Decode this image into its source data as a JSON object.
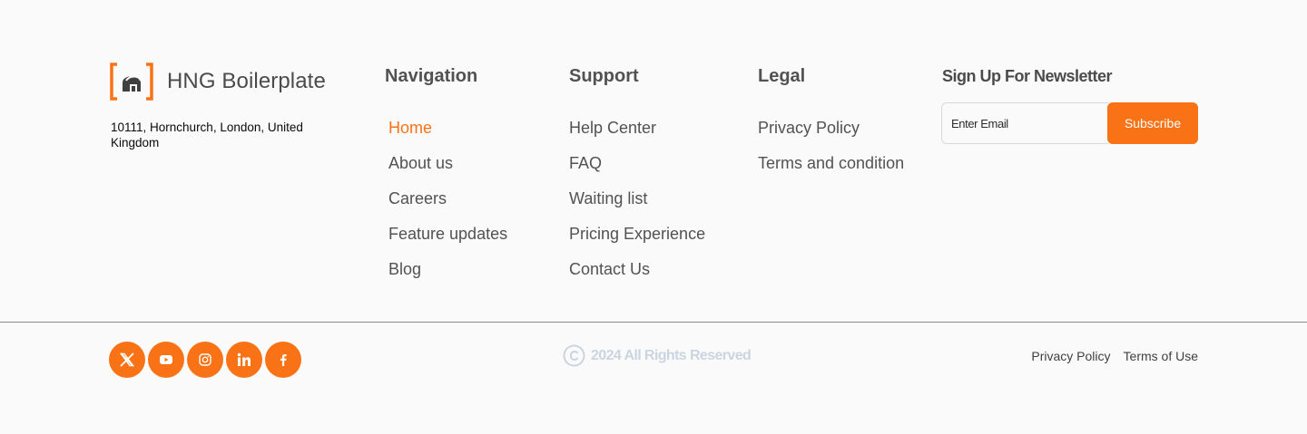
{
  "brand": {
    "name": "HNG Boilerplate",
    "address": "10111, Hornchurch, London, United Kingdom",
    "logo_icon": "bracket-house-logo-icon"
  },
  "columns": {
    "navigation": {
      "title": "Navigation",
      "items": [
        "Home",
        "About us",
        "Careers",
        "Feature updates",
        "Blog"
      ],
      "active": "Home"
    },
    "support": {
      "title": "Support",
      "items": [
        "Help Center",
        "FAQ",
        "Waiting list",
        "Pricing Experience",
        "Contact Us"
      ]
    },
    "legal": {
      "title": "Legal",
      "items": [
        "Privacy Policy",
        "Terms and condition"
      ]
    }
  },
  "newsletter": {
    "title": "Sign Up For Newsletter",
    "email_placeholder": "Enter Email",
    "email_value": "",
    "subscribe_label": "Subscribe"
  },
  "socials": [
    {
      "name": "x",
      "icon": "x-icon"
    },
    {
      "name": "youtube",
      "icon": "youtube-icon"
    },
    {
      "name": "instagram",
      "icon": "instagram-icon"
    },
    {
      "name": "linkedin",
      "icon": "linkedin-icon"
    },
    {
      "name": "facebook",
      "icon": "facebook-icon"
    }
  ],
  "copyright": {
    "text": "2024 All Rights Reserved",
    "icon": "copyright-icon"
  },
  "bottom_links": {
    "privacy": "Privacy Policy",
    "terms": "Terms of Use"
  },
  "colors": {
    "accent": "#f97316",
    "background": "#fafafa",
    "text": "#525252",
    "muted": "#cbd5e1"
  }
}
